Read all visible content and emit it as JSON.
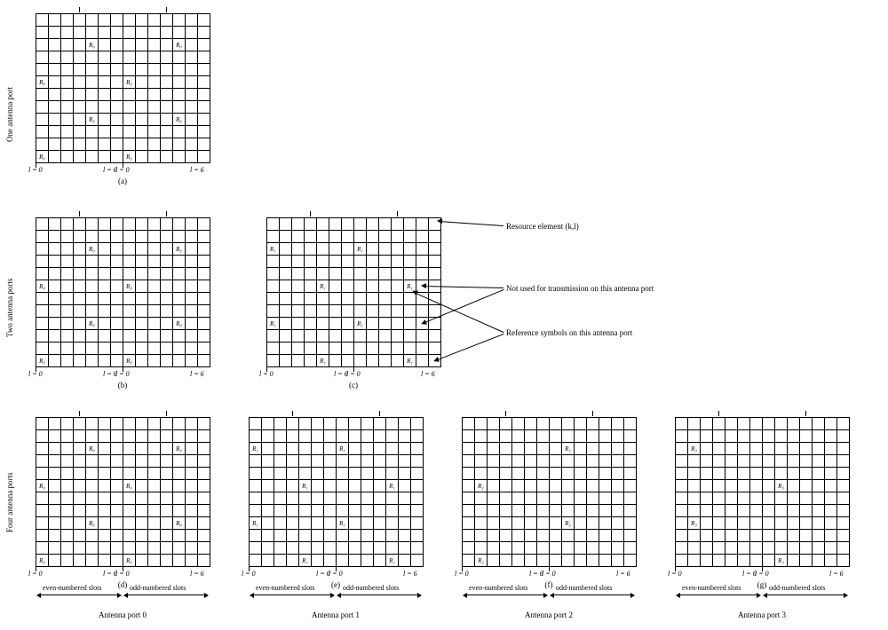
{
  "rowLabels": {
    "one": "One antenna port",
    "two": "Two antenna ports",
    "four": "Four antenna ports"
  },
  "xAxis": {
    "l0": "l = 0",
    "l6": "l = 6"
  },
  "subfig": {
    "a": "(a)",
    "b": "(b)",
    "c": "(c)",
    "d": "(d)",
    "e": "(e)",
    "f": "(f)",
    "g": "(g)"
  },
  "slotLabels": {
    "even": "even-numbered slots",
    "odd": "odd-numbered slots"
  },
  "portLabels": {
    "p0": "Antenna port 0",
    "p1": "Antenna port 1",
    "p2": "Antenna port 2",
    "p3": "Antenna port 3"
  },
  "annotations": {
    "re": "Resource element (k,l)",
    "notused": "Not used for transmission on this antenna port",
    "ref": "Reference symbols on this antenna port"
  },
  "sym": {
    "R0": "R₀",
    "R1": "R₁",
    "R2": "R₂",
    "R3": "R₃"
  },
  "chart_data": {
    "type": "diagram",
    "description": "LTE downlink cell-specific reference signal mapping for 1, 2 and 4 antenna ports, normal cyclic prefix",
    "grid": {
      "subcarriers_k": 12,
      "symbols_l_per_slot": 7,
      "slots_shown": 2
    },
    "configs": [
      {
        "antenna_ports": 1,
        "grids": [
          {
            "port": 0,
            "label": "(a)",
            "refs": [
              {
                "slot": 0,
                "l": 0,
                "k": [
                  0,
                  6
                ]
              },
              {
                "slot": 0,
                "l": 4,
                "k": [
                  3,
                  9
                ]
              },
              {
                "slot": 1,
                "l": 0,
                "k": [
                  0,
                  6
                ]
              },
              {
                "slot": 1,
                "l": 4,
                "k": [
                  3,
                  9
                ]
              }
            ]
          }
        ]
      },
      {
        "antenna_ports": 2,
        "grids": [
          {
            "port": 0,
            "label": "(b)",
            "refs": [
              {
                "slot": 0,
                "l": 0,
                "k": [
                  0,
                  6
                ]
              },
              {
                "slot": 0,
                "l": 4,
                "k": [
                  3,
                  9
                ]
              },
              {
                "slot": 1,
                "l": 0,
                "k": [
                  0,
                  6
                ]
              },
              {
                "slot": 1,
                "l": 4,
                "k": [
                  3,
                  9
                ]
              }
            ]
          },
          {
            "port": 1,
            "label": "(c)",
            "refs": [
              {
                "slot": 0,
                "l": 0,
                "k": [
                  3,
                  9
                ]
              },
              {
                "slot": 0,
                "l": 4,
                "k": [
                  0,
                  6
                ]
              },
              {
                "slot": 1,
                "l": 0,
                "k": [
                  3,
                  9
                ]
              },
              {
                "slot": 1,
                "l": 4,
                "k": [
                  0,
                  6
                ]
              }
            ]
          }
        ]
      },
      {
        "antenna_ports": 4,
        "grids": [
          {
            "port": 0,
            "label": "(d)",
            "refs": [
              {
                "slot": 0,
                "l": 0,
                "k": [
                  0,
                  6
                ]
              },
              {
                "slot": 0,
                "l": 4,
                "k": [
                  3,
                  9
                ]
              },
              {
                "slot": 1,
                "l": 0,
                "k": [
                  0,
                  6
                ]
              },
              {
                "slot": 1,
                "l": 4,
                "k": [
                  3,
                  9
                ]
              }
            ]
          },
          {
            "port": 1,
            "label": "(e)",
            "refs": [
              {
                "slot": 0,
                "l": 0,
                "k": [
                  3,
                  9
                ]
              },
              {
                "slot": 0,
                "l": 4,
                "k": [
                  0,
                  6
                ]
              },
              {
                "slot": 1,
                "l": 0,
                "k": [
                  3,
                  9
                ]
              },
              {
                "slot": 1,
                "l": 4,
                "k": [
                  0,
                  6
                ]
              }
            ]
          },
          {
            "port": 2,
            "label": "(f)",
            "refs": [
              {
                "slot": 0,
                "l": 1,
                "k": [
                  0,
                  6
                ]
              },
              {
                "slot": 1,
                "l": 1,
                "k": [
                  3,
                  9
                ]
              }
            ]
          },
          {
            "port": 3,
            "label": "(g)",
            "refs": [
              {
                "slot": 0,
                "l": 1,
                "k": [
                  3,
                  9
                ]
              },
              {
                "slot": 1,
                "l": 1,
                "k": [
                  0,
                  6
                ]
              }
            ]
          }
        ]
      }
    ]
  }
}
